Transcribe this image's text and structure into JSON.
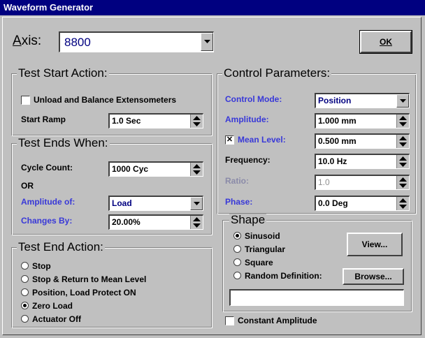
{
  "window": {
    "title": "Waveform Generator"
  },
  "axis": {
    "label": "Axis:",
    "value": "8800"
  },
  "ok_label": "OK",
  "test_start": {
    "title": "Test Start Action:",
    "unload_label": "Unload and Balance Extensometers",
    "unload_checked": false,
    "ramp_label": "Start Ramp",
    "ramp_value": "1.0 Sec"
  },
  "test_ends": {
    "title": "Test Ends When:",
    "cycle_label": "Cycle Count:",
    "cycle_value": "1000 Cyc",
    "or_label": "OR",
    "amp_label": "Amplitude of:",
    "amp_value": "Load",
    "changes_label": "Changes By:",
    "changes_value": "20.00%"
  },
  "end_action": {
    "title": "Test End Action:",
    "options": [
      "Stop",
      "Stop & Return to Mean Level",
      "Position, Load Protect ON",
      "Zero Load",
      "Actuator Off"
    ],
    "selected": "Zero Load"
  },
  "control": {
    "title": "Control Parameters:",
    "mode_label": "Control Mode:",
    "mode_value": "Position",
    "amplitude_label": "Amplitude:",
    "amplitude_value": "1.000 mm",
    "mean_label": "Mean Level:",
    "mean_checked": true,
    "mean_value": "0.500 mm",
    "frequency_label": "Frequency:",
    "frequency_value": "10.0 Hz",
    "ratio_label": "Ratio:",
    "ratio_value": "1.0",
    "phase_label": "Phase:",
    "phase_value": "0.0 Deg"
  },
  "shape": {
    "title": "Shape",
    "options": [
      "Sinusoid",
      "Triangular",
      "Square",
      "Random Definition:"
    ],
    "selected": "Sinusoid",
    "view_label": "View...",
    "browse_label": "Browse...",
    "definition_value": ""
  },
  "constant_amplitude": {
    "label": "Constant Amplitude",
    "checked": false
  },
  "colors": {
    "titlebar": "#000080",
    "face": "#c0c0c0",
    "accent_label": "#3838d8"
  }
}
